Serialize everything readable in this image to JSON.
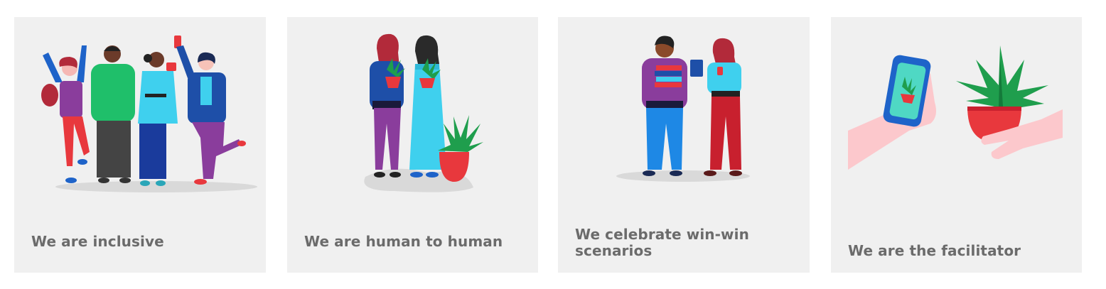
{
  "cards": [
    {
      "title": "We are inclusive",
      "illustration": "group-of-people-illustration"
    },
    {
      "title": "We are human to human",
      "illustration": "two-women-with-plants-illustration"
    },
    {
      "title": "We celebrate win-win scenarios",
      "illustration": "two-people-exchanging-illustration"
    },
    {
      "title": "We are the facilitator",
      "illustration": "hands-phone-plant-illustration"
    }
  ],
  "colors": {
    "card_bg": "#f0f0f0",
    "title_text": "#6b6b6b",
    "red": "#e8383d",
    "green": "#1f9e4d",
    "blue": "#1e63c9",
    "cyan": "#3fd0ee",
    "purple": "#8a3d9c"
  }
}
